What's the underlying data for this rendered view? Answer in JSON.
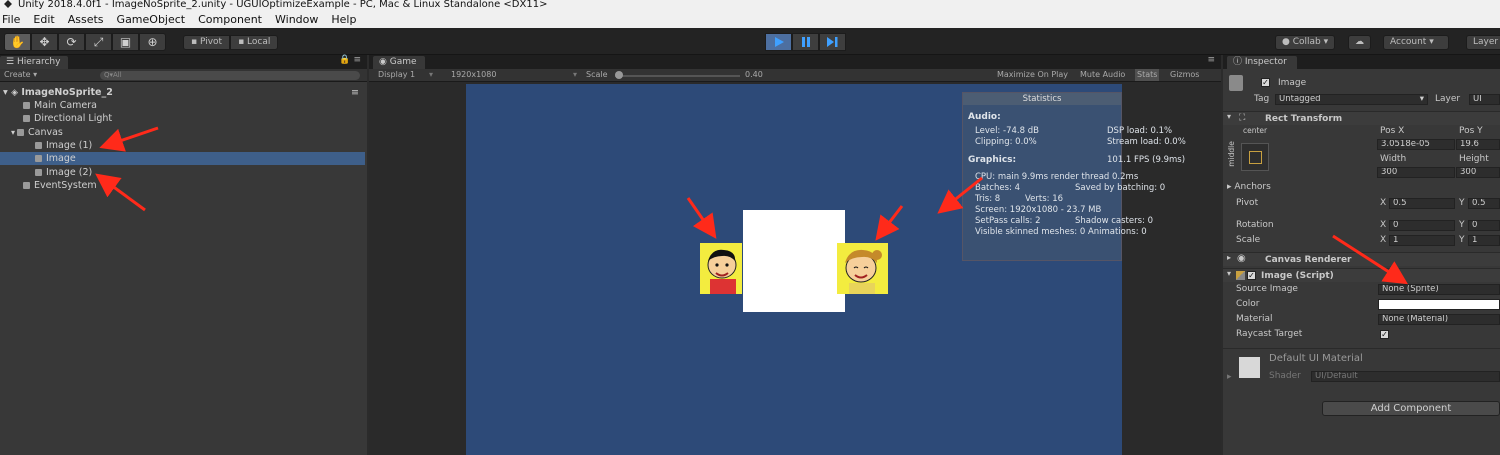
{
  "window": {
    "title": "Unity 2018.4.0f1 - ImageNoSprite_2.unity - UGUIOptimizeExample - PC, Mac & Linux Standalone <DX11>"
  },
  "menu": [
    "File",
    "Edit",
    "Assets",
    "GameObject",
    "Component",
    "Window",
    "Help"
  ],
  "toolbar": {
    "tools": [
      "hand-tool-icon",
      "move-tool-icon",
      "rotate-tool-icon",
      "scale-tool-icon",
      "rect-tool-icon",
      "transform-tool-icon"
    ],
    "pivot": "Pivot",
    "local": "Local",
    "collab": "Collab ▾",
    "account": "Account",
    "layers": "Layer"
  },
  "hierarchy": {
    "tab": "Hierarchy",
    "create": "Create ▾",
    "search_placeholder": "Q▾All",
    "scene": "ImageNoSprite_2",
    "items": [
      {
        "label": "Main Camera",
        "depth": 1
      },
      {
        "label": "Directional Light",
        "depth": 1
      },
      {
        "label": "Canvas",
        "depth": 1,
        "expanded": true
      },
      {
        "label": "Image (1)",
        "depth": 2
      },
      {
        "label": "Image",
        "depth": 2,
        "selected": true
      },
      {
        "label": "Image (2)",
        "depth": 2
      },
      {
        "label": "EventSystem",
        "depth": 1
      }
    ]
  },
  "game": {
    "tab": "Game",
    "display": "Display 1",
    "resolution": "1920x1080",
    "scale_label": "Scale",
    "scale_value": "0.40",
    "maximize": "Maximize On Play",
    "mute": "Mute Audio",
    "stats": "Stats",
    "gizmos": "Gizmos",
    "background_color": "#2d4a78"
  },
  "statistics": {
    "title": "Statistics",
    "audio_heading": "Audio:",
    "level": "Level: -74.8 dB",
    "dsp": "DSP load: 0.1%",
    "clipping": "Clipping: 0.0%",
    "stream": "Stream load: 0.0%",
    "graphics_heading": "Graphics:",
    "fps": "101.1 FPS (9.9ms)",
    "cpu": "CPU: main 9.9ms  render thread 0.2ms",
    "batches": "Batches: 4",
    "saved": "Saved by batching: 0",
    "tris": "Tris: 8",
    "verts": "Verts: 16",
    "screen": "Screen: 1920x1080 - 23.7 MB",
    "setpass": "SetPass calls: 2",
    "shadow": "Shadow casters: 0",
    "skinned": "Visible skinned meshes: 0  Animations: 0"
  },
  "inspector": {
    "tab": "Inspector",
    "object_name": "Image",
    "tag_label": "Tag",
    "tag_value": "Untagged",
    "layer_label": "Layer",
    "layer_value": "UI",
    "rect_transform": {
      "title": "Rect Transform",
      "anchor_h": "center",
      "anchor_v": "middle",
      "posx_label": "Pos X",
      "posx": "3.0518e-05",
      "posy_label": "Pos Y",
      "posy": "19.6",
      "width_label": "Width",
      "width": "300",
      "height_label": "Height",
      "height": "300",
      "anchors": "Anchors",
      "pivot": "Pivot",
      "pivot_x": "0.5",
      "pivot_y": "0.5",
      "rotation": "Rotation",
      "rot_x": "0",
      "rot_y": "0",
      "scale": "Scale",
      "scale_x": "1",
      "scale_y": "1",
      "x": "X",
      "y": "Y"
    },
    "canvas_renderer": "Canvas Renderer",
    "image_script": {
      "title": "Image (Script)",
      "source_label": "Source Image",
      "source_value": "None (Sprite)",
      "color_label": "Color",
      "color_value": "#ffffff",
      "material_label": "Material",
      "material_value": "None (Material)",
      "raycast_label": "Raycast Target",
      "raycast_checked": true
    },
    "material": {
      "name": "Default UI Material",
      "shader_label": "Shader",
      "shader_value": "UI/Default"
    },
    "add_component": "Add Component"
  }
}
